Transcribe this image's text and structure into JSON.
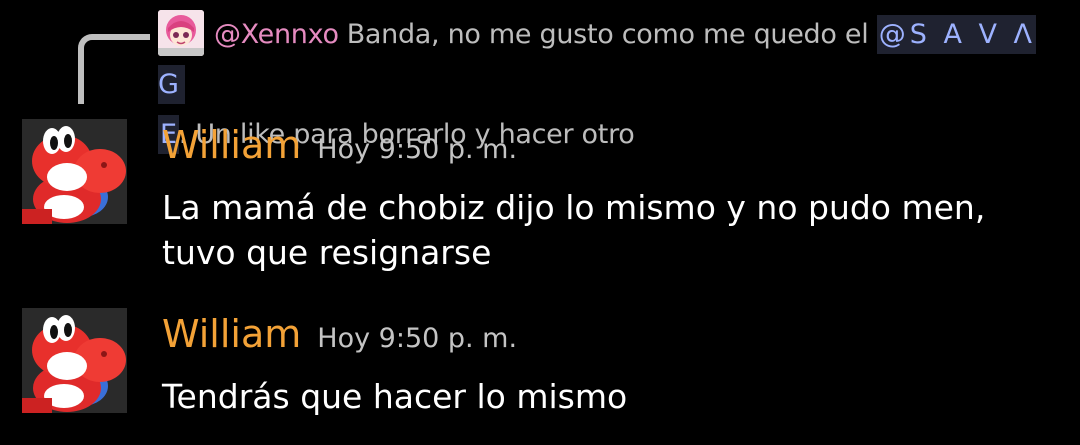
{
  "reply": {
    "author": "@Xennxo",
    "text_before": "Banda, no me gusto como me quedo el",
    "mention_part1": "@S A V Λ G",
    "mention_part2": "E",
    "text_after": ". Un like para borrarlo y hacer otro"
  },
  "messages": [
    {
      "username": "William",
      "timestamp": "Hoy 9:50 p. m.",
      "text": "La mamá de chobiz dijo lo mismo y no pudo men, tuvo que resignarse"
    },
    {
      "username": "William",
      "timestamp": "Hoy 9:50 p. m.",
      "text": "Tendrás que hacer lo mismo"
    }
  ],
  "colors": {
    "background": "#000000",
    "username": "#f3a237",
    "reply_author": "#e58bc0",
    "mention_bg": "#1f2230",
    "mention_text": "#9db2ff"
  },
  "icons": {
    "reply_avatar": "anime-girl-avatar-icon",
    "user_avatar": "red-yoshi-avatar-icon"
  }
}
